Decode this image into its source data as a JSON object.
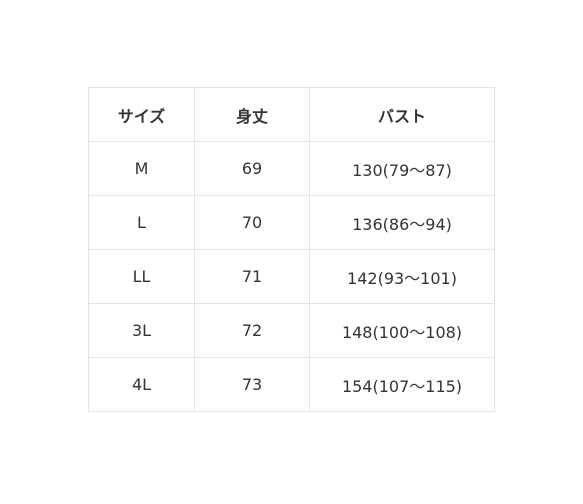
{
  "size_table": {
    "headers": [
      "サイズ",
      "身丈",
      "バスト"
    ],
    "rows": [
      {
        "size": "M",
        "length": "69",
        "bust": "130(79〜87)"
      },
      {
        "size": "L",
        "length": "70",
        "bust": "136(86〜94)"
      },
      {
        "size": "LL",
        "length": "71",
        "bust": "142(93〜101)"
      },
      {
        "size": "3L",
        "length": "72",
        "bust": "148(100〜108)"
      },
      {
        "size": "4L",
        "length": "73",
        "bust": "154(107〜115)"
      }
    ]
  },
  "colors": {
    "border": "#e3e3e3",
    "text": "#333333",
    "background": "#ffffff"
  }
}
